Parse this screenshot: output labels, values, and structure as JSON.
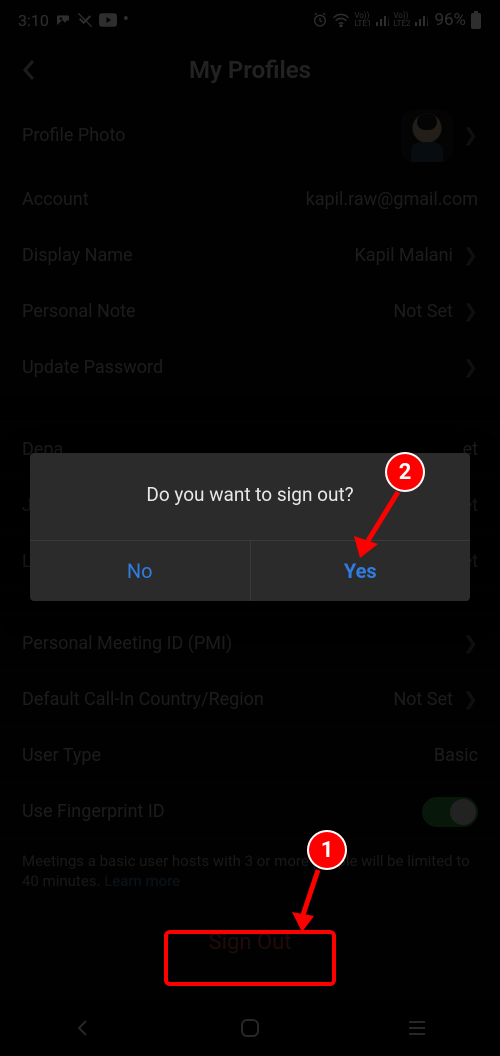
{
  "status": {
    "time": "3:10",
    "battery": "96%",
    "sim1": "LTE1",
    "sim2": "LTE2"
  },
  "header": {
    "title": "My Profiles"
  },
  "rows": {
    "profile_photo": "Profile Photo",
    "account_label": "Account",
    "account_value": "kapil.raw@gmail.com",
    "display_name_label": "Display Name",
    "display_name_value": "Kapil Malani",
    "personal_note_label": "Personal Note",
    "personal_note_value": "Not Set",
    "update_password": "Update Password",
    "department_label": "Depa",
    "department_value": "et",
    "job_label": "Job",
    "job_value": "et",
    "location_label": "Loca",
    "location_value": "et",
    "pmi_label": "Personal Meeting ID (PMI)",
    "callin_label": "Default Call-In Country/Region",
    "callin_value": "Not Set",
    "user_type_label": "User Type",
    "user_type_value": "Basic",
    "fingerprint_label": "Use Fingerprint ID"
  },
  "note": {
    "text": "Meetings a basic user hosts with 3 or more people will be limited to 40 minutes. ",
    "link": "Learn more"
  },
  "signout": "Sign Out",
  "dialog": {
    "message": "Do you want to sign out?",
    "no": "No",
    "yes": "Yes"
  },
  "annotations": {
    "b1": "1",
    "b2": "2"
  }
}
